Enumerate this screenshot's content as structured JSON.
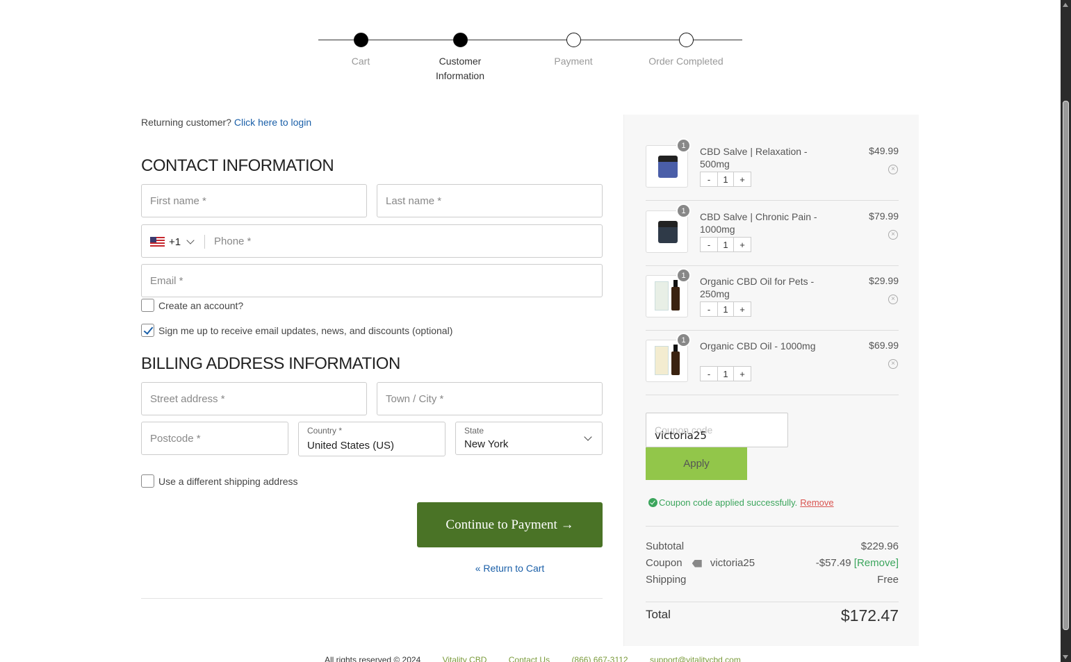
{
  "stepper": {
    "steps": [
      {
        "label": "Cart"
      },
      {
        "label": "Customer Information"
      },
      {
        "label": "Payment"
      },
      {
        "label": "Order Completed"
      }
    ]
  },
  "login": {
    "prompt": "Returning customer?",
    "link": "Click here to login"
  },
  "contact": {
    "title": "CONTACT INFORMATION",
    "first_name_ph": "First name *",
    "last_name_ph": "Last name *",
    "phone_code": "+1",
    "phone_ph": "Phone *",
    "email_ph": "Email *",
    "create_account": "Create an account?",
    "signup": "Sign me up to receive email updates, news, and discounts (optional)"
  },
  "billing": {
    "title": "BILLING ADDRESS INFORMATION",
    "street_ph": "Street address *",
    "city_ph": "Town / City *",
    "postcode_ph": "Postcode *",
    "country_label": "Country *",
    "country_value": "United States (US)",
    "state_label": "State",
    "state_value": "New York",
    "diff_shipping": "Use a different shipping address"
  },
  "actions": {
    "continue": "Continue to Payment →",
    "return": "« Return to Cart"
  },
  "cart": {
    "items": [
      {
        "name": "CBD Salve | Relaxation - 500mg",
        "price": "$49.99",
        "qty": "1",
        "badge": "1"
      },
      {
        "name": "CBD Salve | Chronic Pain - 1000mg",
        "price": "$79.99",
        "qty": "1",
        "badge": "1"
      },
      {
        "name": "Organic CBD Oil for Pets - 250mg",
        "price": "$29.99",
        "qty": "1",
        "badge": "1"
      },
      {
        "name": "Organic CBD Oil - 1000mg",
        "price": "$69.99",
        "qty": "1",
        "badge": "1"
      }
    ],
    "minus": "-",
    "plus": "+",
    "remove_glyph": "×"
  },
  "coupon": {
    "placeholder": "Coupon code",
    "value": "victoria25",
    "apply": "Apply",
    "success": "Coupon code applied successfully.",
    "remove": "Remove"
  },
  "totals": {
    "subtotal_label": "Subtotal",
    "subtotal": "$229.96",
    "coupon_label": "Coupon",
    "coupon_code": "victoria25",
    "coupon_amount": "-$57.49",
    "coupon_remove": "[Remove]",
    "shipping_label": "Shipping",
    "shipping": "Free",
    "total_label": "Total",
    "total": "$172.47"
  },
  "footer": {
    "rights": "All rights reserved © 2024",
    "brand": "Vitality CBD",
    "contact": "Contact Us",
    "phone": "(866) 667-3112",
    "email": "support@vitalitycbd.com"
  }
}
